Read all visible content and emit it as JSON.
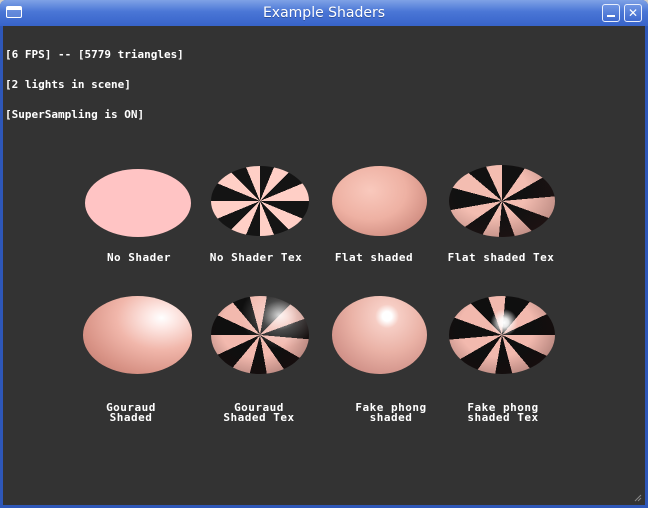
{
  "window": {
    "title": "Example Shaders",
    "minimize_glyph": "_",
    "close_glyph": "✕"
  },
  "hud": {
    "lines": [
      "[6 FPS] -- [5779 triangles]",
      "[2 lights in scene]",
      "[SuperSampling is ON]"
    ]
  },
  "demos": [
    {
      "label_lines": [
        "No Shader"
      ],
      "style": "flat-pink"
    },
    {
      "label_lines": [
        "No Shader Tex"
      ],
      "style": "checker-flat"
    },
    {
      "label_lines": [
        "Flat shaded"
      ],
      "style": "flat-shaded"
    },
    {
      "label_lines": [
        "Flat shaded Tex"
      ],
      "style": "checker-shaded"
    },
    {
      "label_lines": [
        "Gouraud",
        "Shaded"
      ],
      "style": "gouraud"
    },
    {
      "label_lines": [
        "Gouraud",
        "Shaded Tex"
      ],
      "style": "checker-gouraud"
    },
    {
      "label_lines": [
        "Fake phong",
        "shaded"
      ],
      "style": "phong"
    },
    {
      "label_lines": [
        "Fake phong",
        "shaded Tex"
      ],
      "style": "checker-phong"
    }
  ],
  "colors": {
    "viewport_background": "#333333",
    "sphere_base": "#ffc4c4",
    "checker_dark": "#141414",
    "titlebar_blue": "#3763c9"
  }
}
